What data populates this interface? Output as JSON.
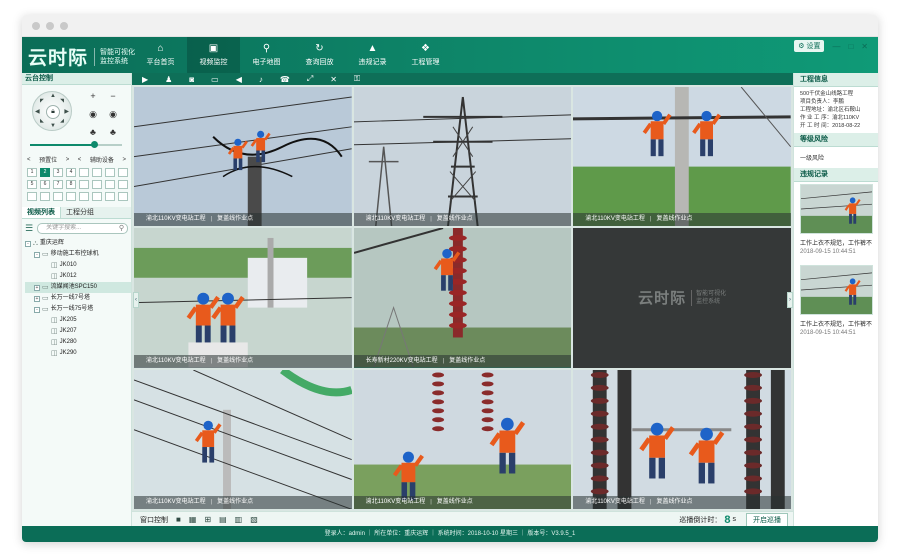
{
  "app": {
    "logo_mark": "云时际",
    "logo_sub_1": "智能可视化",
    "logo_sub_2": "监控系统"
  },
  "nav": [
    {
      "label": "平台首页",
      "icon": "home-icon",
      "glyph": "⌂",
      "active": false
    },
    {
      "label": "视频监控",
      "icon": "camera-icon",
      "glyph": "▣",
      "active": true
    },
    {
      "label": "电子地图",
      "icon": "map-pin-icon",
      "glyph": "⚲",
      "active": false
    },
    {
      "label": "查询回放",
      "icon": "replay-icon",
      "glyph": "↻",
      "active": false
    },
    {
      "label": "违规记录",
      "icon": "warning-icon",
      "glyph": "▲",
      "active": false
    },
    {
      "label": "工程管理",
      "icon": "settings-icon",
      "glyph": "❖",
      "active": false
    }
  ],
  "header_right": {
    "settings_label": "设置",
    "minimize": "—",
    "maximize": "□",
    "close": "✕"
  },
  "left_panel": {
    "ptz_title": "云台控制",
    "preset_label": "预置位",
    "aux_label": "辅助设备",
    "presets": [
      "1",
      "2",
      "3",
      "4",
      "",
      "",
      "",
      "",
      "5",
      "6",
      "7",
      "8",
      "",
      "",
      "",
      "",
      "",
      "",
      "",
      "",
      "",
      "",
      "",
      ""
    ],
    "tabs": [
      "视频列表",
      "工程分组"
    ],
    "search_placeholder": "关键字搜索...",
    "tree": [
      {
        "label": "重庆运辉",
        "level": 0,
        "toggle": "-",
        "icon": "org-icon"
      },
      {
        "label": "移动施工布控球机",
        "level": 1,
        "toggle": "-",
        "icon": "folder-icon"
      },
      {
        "label": "JK010",
        "level": 2,
        "toggle": "",
        "icon": "camera-icon"
      },
      {
        "label": "JK012",
        "level": 2,
        "toggle": "",
        "icon": "camera-icon"
      },
      {
        "label": "流媒闻池SPC150",
        "level": 1,
        "toggle": "+",
        "icon": "folder-icon",
        "selected": true
      },
      {
        "label": "长万一线7号塔",
        "level": 1,
        "toggle": "+",
        "icon": "folder-icon"
      },
      {
        "label": "长万一线75号塔",
        "level": 1,
        "toggle": "-",
        "icon": "folder-icon"
      },
      {
        "label": "JK205",
        "level": 2,
        "toggle": "",
        "icon": "camera-icon"
      },
      {
        "label": "JK207",
        "level": 2,
        "toggle": "",
        "icon": "camera-icon"
      },
      {
        "label": "JK280",
        "level": 2,
        "toggle": "",
        "icon": "camera-icon"
      },
      {
        "label": "JK290",
        "level": 2,
        "toggle": "",
        "icon": "camera-icon"
      }
    ]
  },
  "toolbar": [
    {
      "icon": "play-icon",
      "glyph": "▶"
    },
    {
      "icon": "users-icon",
      "glyph": "♟"
    },
    {
      "icon": "snapshot-icon",
      "glyph": "◙"
    },
    {
      "icon": "monitor-icon",
      "glyph": "▭"
    },
    {
      "icon": "volume-icon",
      "glyph": "◀"
    },
    {
      "icon": "mic-icon",
      "glyph": "♪"
    },
    {
      "icon": "phone-icon",
      "glyph": "☎"
    },
    {
      "icon": "fullscreen-icon",
      "glyph": "⤢"
    },
    {
      "icon": "close-all-icon",
      "glyph": "✕"
    },
    {
      "icon": "lock-icon",
      "glyph": "⚿"
    }
  ],
  "videos": [
    {
      "station": "渝北110KV变电站工程",
      "point": "复盖线作业点",
      "scene": "tower-workers"
    },
    {
      "station": "渝北110KV变电站工程",
      "point": "复盖线作业点",
      "scene": "pylon"
    },
    {
      "station": "渝北110KV变电站工程",
      "point": "复盖线作业点",
      "scene": "pole-workers"
    },
    {
      "station": "渝北110KV变电站工程",
      "point": "复盖线作业点",
      "scene": "substation"
    },
    {
      "station": "长寿新村220KV变电站工程",
      "point": "复盖线作业点",
      "scene": "insulator-climb"
    },
    {
      "station": "",
      "point": "",
      "scene": "nosignal"
    },
    {
      "station": "渝北110KV变电站工程",
      "point": "复盖线作业点",
      "scene": "pole-climber"
    },
    {
      "station": "渝北110KV变电站工程",
      "point": "复盖线作业点",
      "scene": "insulator-work"
    },
    {
      "station": "渝北110KV变电站工程",
      "point": "复盖线作业点",
      "scene": "breaker-work"
    }
  ],
  "nosignal": {
    "mark": "云时际",
    "sub_1": "智能可视化",
    "sub_2": "监控系统"
  },
  "bottom": {
    "window_control": "窗口控制",
    "timer_label": "巡播倒计时：",
    "timer_value": "8",
    "timer_unit": "s",
    "start_button": "开启巡播"
  },
  "right_panel": {
    "info_title": "工程信息",
    "info_lines": [
      "500千伏金山线路工程",
      "项目负责人：李鹏",
      "工程地址：渝北区石鞍山",
      "作 业 工 序：渝北110KV",
      "开 工 时 间：2018-08-22"
    ],
    "risk_title": "等级风险",
    "risk_value": "一级风险",
    "record_title": "违规记录",
    "records": [
      {
        "text": "工作上衣不规范，工作裤不",
        "time": "2018-09-15 10:44:51"
      },
      {
        "text": "工作上衣不规范，工作裤不",
        "time": "2018-09-15 10:44:51"
      }
    ]
  },
  "statusbar": "登录人：admin ｜ 所在单位：重庆运辉 ｜ 系统时间：2018-10-10 星期三 ｜ 版本号：V3.9.5_1"
}
